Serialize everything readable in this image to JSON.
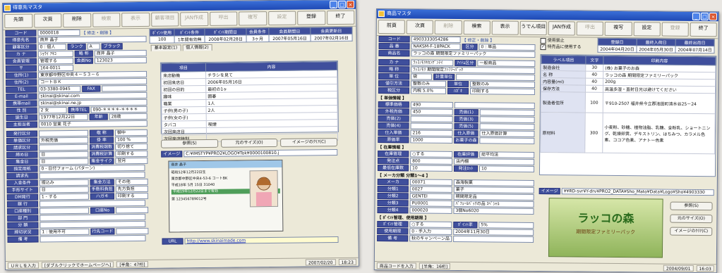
{
  "w1": {
    "title": "得意先マスタ",
    "toolbar": [
      "先頭",
      "次頁",
      "削除",
      "検索",
      "表示",
      "顧客項目",
      "JAN作成",
      "呼出",
      "複写",
      "設定",
      "登録",
      "終了"
    ],
    "toolbar_disabled": [
      false,
      false,
      false,
      true,
      true,
      true,
      true,
      true,
      true,
      true,
      false,
      false
    ],
    "code": {
      "label": "コード",
      "value": "0000018",
      "note": "【 修正・削除 】"
    },
    "name": {
      "label": "得意先名",
      "value": "商井 晶子"
    },
    "cls": {
      "label": "顧客区分",
      "value": "0 : 個人",
      "rank_label": "ランク",
      "rank": "A",
      "black_label": "ブラック"
    },
    "kana": {
      "label": "カ ナ",
      "value": "ｼｮｳｲ ｱｷｺ",
      "kana2_label": "略 称",
      "kana2": "商井 晶子"
    },
    "mgr": {
      "label": "会員管理",
      "value": "管理する",
      "no_label": "会員No",
      "no": "123023"
    },
    "zip": {
      "label": "〒",
      "value": "164-0011"
    },
    "addr1": {
      "label": "住所(1)",
      "value": "東京都中野区中央４－５３－６"
    },
    "addr2": {
      "label": "住所(2)",
      "value": "コートＢＫ"
    },
    "tel": {
      "label": "TEL",
      "value": "03-3380-0945",
      "fax_label": "FAX"
    },
    "email": {
      "label": "E-mail",
      "value": "skinai@skinai.com"
    },
    "mobile": {
      "label": "携帯mail",
      "value": "skinai@skinai.ne.jp"
    },
    "sex": {
      "label": "性 別",
      "value": "2 女",
      "mtel_label": "携帯TEL",
      "mtel": "090-＊＊＊＊-＊＊＊＊"
    },
    "birth": {
      "label": "誕生日",
      "value": "1977年12月22日",
      "age_label": "年齢",
      "age": "28歳"
    },
    "staff": {
      "label": "主担当者",
      "value": "0010 営業 花子"
    },
    "left_rows": [
      {
        "label": "発行区分",
        "value": "",
        "b_label": "敬 称",
        "b": "御中"
      },
      {
        "label": "単価区分",
        "value": "外税売価",
        "b_label": "掛 率",
        "b": "100 %"
      },
      {
        "label": "請求区分",
        "value": "",
        "b_label": "消費税端数",
        "b": "切り捨て"
      },
      {
        "label": "締め日",
        "value": "日",
        "b_label": "消費税計算",
        "b": "印刷する"
      },
      {
        "label": "集金日",
        "value": "日",
        "b_label": "集金サイクル",
        "b": "翌月"
      },
      {
        "label": "指定用紙",
        "value": "0 - 日付フォーム (パターン)",
        "b_label": "",
        "b": ""
      },
      {
        "label": "請求先",
        "value": "",
        "b_label": "",
        "b": ""
      },
      {
        "label": "入金条件",
        "value": "振込み",
        "b_label": "集金方法",
        "b": "その他"
      },
      {
        "label": "手形サイト",
        "value": "日",
        "b_label": "手数料負担",
        "b": "先方負担"
      },
      {
        "label": "DM発行",
        "value": "1 - する",
        "b_label": "ハガキ",
        "b": "印刷する"
      },
      {
        "label": "銀 行",
        "value": "",
        "b_label": "",
        "b": ""
      },
      {
        "label": "口座種別",
        "value": "",
        "b_label": "口座No",
        "b": ""
      },
      {
        "label": "部 門",
        "value": "",
        "b_label": "",
        "b": ""
      },
      {
        "label": "分 類",
        "value": "",
        "b_label": "",
        "b": ""
      },
      {
        "label": "締切状況",
        "value": "1 : 使用不可",
        "b_label": "行先コード",
        "b": ""
      },
      {
        "label": "備 考",
        "value": "",
        "b_label": "",
        "b": ""
      }
    ],
    "summary_headers": [
      "ﾎﾟｲﾝﾄ使用",
      "ﾎﾟｲﾝﾄ条件",
      "ﾎﾟｲﾝﾄ期間日",
      "会員条件",
      "会員期間日",
      "会員更新日"
    ],
    "summary_values": [
      "100",
      "1年間有効無",
      "2008年02月28日",
      "3ヶ月",
      "2007年05月16日",
      "2007年02月16日"
    ],
    "tabs": [
      "基本設定(1)",
      "個人情報(2)"
    ],
    "grid_headers": [
      "項目",
      "内容"
    ],
    "grid_rows": [
      [
        "来店動機",
        "チラシを見て"
      ],
      [
        "初回来店日",
        "2006年05月16日"
      ],
      [
        "初回の目的",
        "最初の1ヶ"
      ],
      [
        "趣味",
        "囲碁"
      ],
      [
        "職業",
        "1人"
      ],
      [
        "子供(男の子)",
        "2人"
      ],
      [
        "子供(女の子)",
        ""
      ],
      [
        "タバコ",
        "喫煙"
      ],
      [
        "次回来店日",
        ""
      ],
      [
        "次回来店時刻",
        ""
      ]
    ],
    "card_buttons": [
      "参照(S)",
      "元のサイズ(O)",
      "イメージのｸﾘｱ(C)"
    ],
    "image_label": "イメージ",
    "image_path": "C:¥IMSTYP¥PRO2¥LOGO¥Tok¥0000100810.j",
    "card": {
      "name": "商井 晶子",
      "birth": "昭和52年12月22日生",
      "addr": "東京都中野区中央4-53-6 コートBK",
      "issue": "平成18年 5月 15日 31040",
      "license_no": "第 123456789012号",
      "colour_band": "平成19年12月22日まで有効"
    },
    "url_label": "URL",
    "url": "http://www.skinaimade.com",
    "status": [
      "ＵＲＬを入力",
      "[ダブルクリックでホームページへ]",
      "[半角：47桁]",
      "2007/02/20",
      "18:23"
    ]
  },
  "w2": {
    "title": "商品マスタ",
    "toolbar": [
      "前頁",
      "次頁",
      "削除",
      "検索",
      "表示",
      "うでん項目",
      "JAN作成",
      "呼出",
      "複写",
      "設定",
      "登録",
      "終了"
    ],
    "toolbar_disabled": [
      false,
      false,
      true,
      false,
      false,
      false,
      false,
      true,
      false,
      false,
      true,
      false
    ],
    "code": {
      "label": "コード",
      "value": "4903333054286",
      "note": "【 修正・削除 】"
    },
    "item": {
      "label": "品 番",
      "value": "NAKSM-F-18PACK",
      "cls_label": "区分",
      "cls": "0 : 単品"
    },
    "name": {
      "label": "商品名",
      "value": "ラッコの森 期間限定ファミリーパック"
    },
    "kana": {
      "label": "カ ナ",
      "value": "ﾗｯｺﾉﾓﾘｷｶﾝｹﾞﾝﾃｲ",
      "unit_label": "ｱｲﾃﾑ区分",
      "unit": "一般商品"
    },
    "short": {
      "label": "略 称",
      "value": "ﾗｯｺﾉﾓﾘ 期間限定ﾌｧﾐﾘｰﾊﾟｯｸ"
    },
    "unit_name": {
      "label": "単 位",
      "value": "袋",
      "std_label": "計量単位",
      "std": ""
    },
    "tax": {
      "label": "税区分",
      "value": "内税 5.0%",
      "print_label": "ﾊｶﾞｷ",
      "print": "印刷する"
    },
    "discount": {
      "label": "値引方法",
      "value": "整数のみ",
      "b_label": "単位",
      "b": "整数のみ"
    },
    "flags": [
      "使用禁止",
      "特売品に使用する"
    ],
    "top_headers": [
      "登録日",
      "最終入荷日",
      "最終出荷日"
    ],
    "top_values": [
      "2004年04月20日",
      "2004年05月30日",
      "2004年07月14日"
    ],
    "label_headers": [
      "ラベル項目",
      "文字",
      "印刷内容"
    ],
    "label_rows": [
      [
        "製造会社",
        "30",
        "(株) お菓子のお森"
      ],
      [
        "名 称",
        "40",
        "ラッコの森 期間限定ファミリーパック"
      ],
      [
        "内容量(ml)",
        "40",
        "200g"
      ],
      [
        "保存方法",
        "40",
        "高温多湿・直射日光は避けてください"
      ],
      [
        "製造者住所",
        "100",
        "〒910-2507 福井県今立郡池田町清水谷25－24"
      ],
      [
        "原材料",
        "300",
        "小麦粉、砂糖、植物油脂、乳糖、全粉乳、ショートニング、乾燥卵黄、デキストリン、はちみつ、カラメル色素、ココア色素、アナトー色素"
      ]
    ],
    "price_section": "【 単価情報 】",
    "price_rows": [
      {
        "label": "標準価格",
        "value": "490",
        "b_label": "",
        "b": ""
      },
      {
        "label": "外税売価",
        "value": "450",
        "b_label": "売価(1)",
        "b": ""
      },
      {
        "label": "売価(2)",
        "value": "",
        "b_label": "売価(3)",
        "b": ""
      },
      {
        "label": "売価(4)",
        "value": "",
        "b_label": "売価(5)",
        "b": ""
      },
      {
        "label": "仕入単価",
        "value": "216",
        "b_label": "仕入原価",
        "b": "仕入原価計算"
      },
      {
        "label": "原価率",
        "value": "1000",
        "b_label": "お菓子の森",
        "b": ""
      }
    ],
    "stock_section": "【 在庫情報 】",
    "stock_rows": [
      {
        "label": "在庫管理",
        "value": "○する",
        "b_label": "在庫評価",
        "b": "総平均法"
      },
      {
        "label": "発注点",
        "value": "800",
        "b_label": "",
        "b": "店内棚"
      },
      {
        "label": "最低在庫数",
        "value": "10",
        "b_label": "発注ﾛｯﾄ",
        "b": "10"
      }
    ],
    "maker_section": "【 メーカ分類 分類1～4 】",
    "maker_rows": [
      {
        "label": "メーカ",
        "value": "00071",
        "b": "森海製菓"
      },
      {
        "label": "分類1",
        "value": "0027",
        "b": "菓子"
      },
      {
        "label": "分類2",
        "value": "GENTEI",
        "b": "期間限定品"
      },
      {
        "label": "分類3",
        "value": "PU0001",
        "b": "ﾊﾟﾌｪｰﾙﾊﾟｯｸの品 ｽﾍﾟｼｬﾙ"
      },
      {
        "label": "分類4",
        "value": "000020",
        "b": "3個No6020"
      }
    ],
    "point_section": "【 ﾎﾟｲﾝﾄ管理、使用期限 】",
    "point_rows": [
      {
        "label": "ﾎﾟｲﾝﾄ管理",
        "value": "○する",
        "b_label": "ﾎﾟｲﾝﾄ率",
        "b": "5%"
      },
      {
        "label": "使用期限",
        "value": "0 - 手入力",
        "b_label": "",
        "b": "2004年11月30日"
      },
      {
        "label": "備 考",
        "value": "秋のキャンペーン品",
        "b_label": "",
        "b": ""
      }
    ],
    "image_label": "イメージ",
    "image_path": "¥¥RD-svr¥Y-drv¥PRO2_DATA¥Sho_Mato¥Data¥Logo¥Sho¥4903330",
    "package": {
      "title": "ラッコの森",
      "sub": "期間限定ファミリーパック"
    },
    "image_buttons": [
      "参照(S)",
      "元のサイズ(O)",
      "イメージのｸﾘｱ(C)"
    ],
    "status": [
      "商品コードを入力",
      "[半角：16桁]",
      "2004/09/01",
      "16:03"
    ]
  }
}
